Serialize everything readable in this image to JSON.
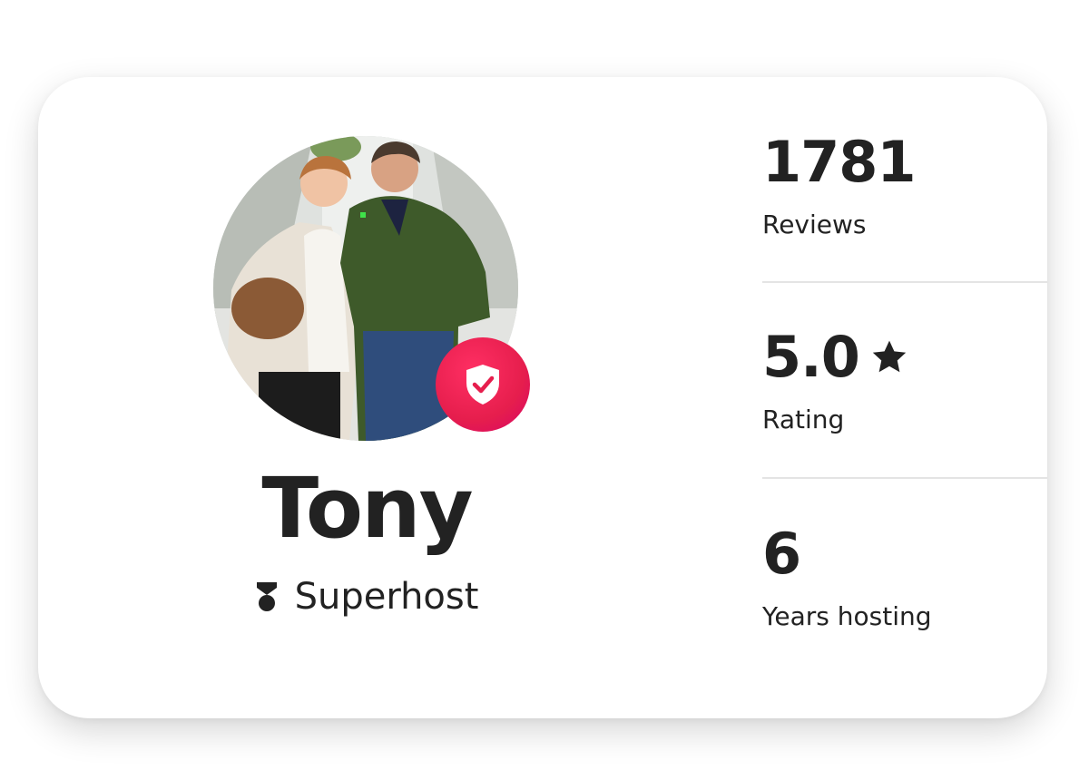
{
  "host": {
    "name": "Tony",
    "badge_label": "Superhost"
  },
  "stats": {
    "reviews": {
      "value": "1781",
      "label": "Reviews"
    },
    "rating": {
      "value": "5.0",
      "label": "Rating"
    },
    "years": {
      "value": "6",
      "label": "Years hosting"
    }
  },
  "icons": {
    "verified": "shield-check-icon",
    "superhost": "superhost-medal-icon",
    "rating": "star-icon"
  },
  "colors": {
    "accent": "#E61E4D",
    "text": "#222222",
    "divider": "#E4E4E4",
    "card_background": "#FFFFFF"
  }
}
